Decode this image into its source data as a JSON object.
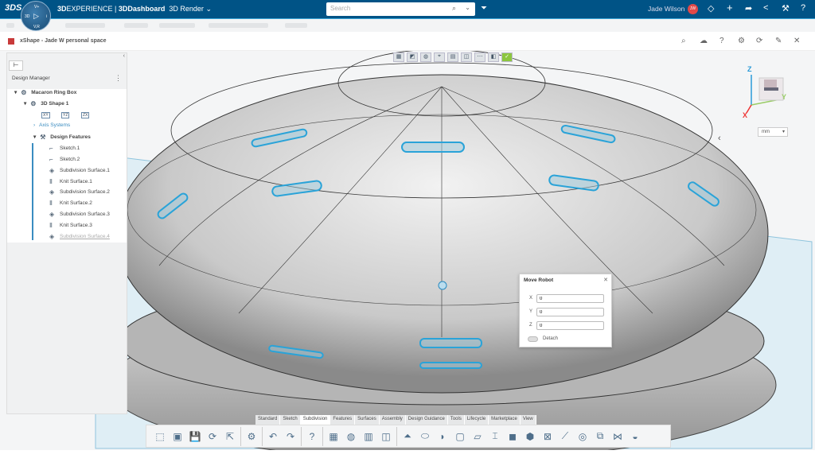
{
  "topbar": {
    "logo": "3DS",
    "compass": {
      "top": "V+",
      "left": "3D",
      "right": "i",
      "bottom": "V,R"
    },
    "brand_bold": "3D",
    "brand_rest": "EXPERIENCE | ",
    "app": "3DDashboard",
    "dashboard": "3D Render",
    "dashboard_chevron": "⌄",
    "search_placeholder": "Search",
    "user_name": "Jade Wilson",
    "user_initials": "JW",
    "accent": "#005386"
  },
  "titlebar": {
    "title": "xShape - Jade W personal space"
  },
  "panel": {
    "title": "Design Manager",
    "tree": [
      {
        "label": "Macaron Ring Box",
        "icon": "part-icon",
        "arrow": "▾",
        "bold": true
      },
      {
        "label": "3D Shape 1",
        "icon": "shape-icon",
        "arrow": "▾",
        "bold": true
      },
      {
        "label": "Axis Systems",
        "icon": "",
        "arrow": "›",
        "link": true
      },
      {
        "label": "Design Features",
        "icon": "features-icon",
        "arrow": "▾",
        "bold": true
      },
      {
        "label": "Sketch.1",
        "icon": "sketch-icon"
      },
      {
        "label": "Sketch.2",
        "icon": "sketch-icon"
      },
      {
        "label": "Subdivision Surface.1",
        "icon": "subdivision-icon"
      },
      {
        "label": "Knit Surface.1",
        "icon": "knit-icon"
      },
      {
        "label": "Subdivision Surface.2",
        "icon": "subdivision-icon"
      },
      {
        "label": "Knit Surface.2",
        "icon": "knit-icon"
      },
      {
        "label": "Subdivision Surface.3",
        "icon": "subdivision-icon"
      },
      {
        "label": "Knit Surface.3",
        "icon": "knit-icon"
      },
      {
        "label": "Subdivision Surface.4",
        "icon": "subdivision-icon",
        "dim": true
      }
    ],
    "planes": [
      "XY",
      "YZ",
      "ZX"
    ]
  },
  "dialog": {
    "title": "Move Robot",
    "x_label": "X",
    "x": "0",
    "y_label": "Y",
    "y": "0",
    "z_label": "Z",
    "z": "0",
    "detach": "Detach"
  },
  "units": "mm",
  "compass3d": {
    "x": "X",
    "y": "Y",
    "z": "Z"
  },
  "tabs": [
    "Standard",
    "Sketch",
    "Subdivision",
    "Features",
    "Surfaces",
    "Assembly",
    "Design Guidance",
    "Tools",
    "Lifecycle",
    "Marketplace",
    "View"
  ],
  "active_tab": "Subdivision",
  "tools": [
    "select-icon",
    "cube-icon",
    "save-icon",
    "update-icon",
    "export-icon",
    "|",
    "settings-icon",
    "|",
    "undo-icon",
    "redo-icon",
    "|",
    "help-icon",
    "|",
    "grid-icon",
    "sphere-icon",
    "lattice-icon",
    "box-icon",
    "|",
    "extrude-icon",
    "cylinder-icon",
    "surface-icon",
    "face-icon",
    "plane-icon",
    "bridge-icon",
    "patch-icon",
    "solid-icon",
    "delete-icon",
    "sweep-icon",
    "globe-icon",
    "mirror-icon",
    "symmetry-icon",
    "cap-icon"
  ]
}
